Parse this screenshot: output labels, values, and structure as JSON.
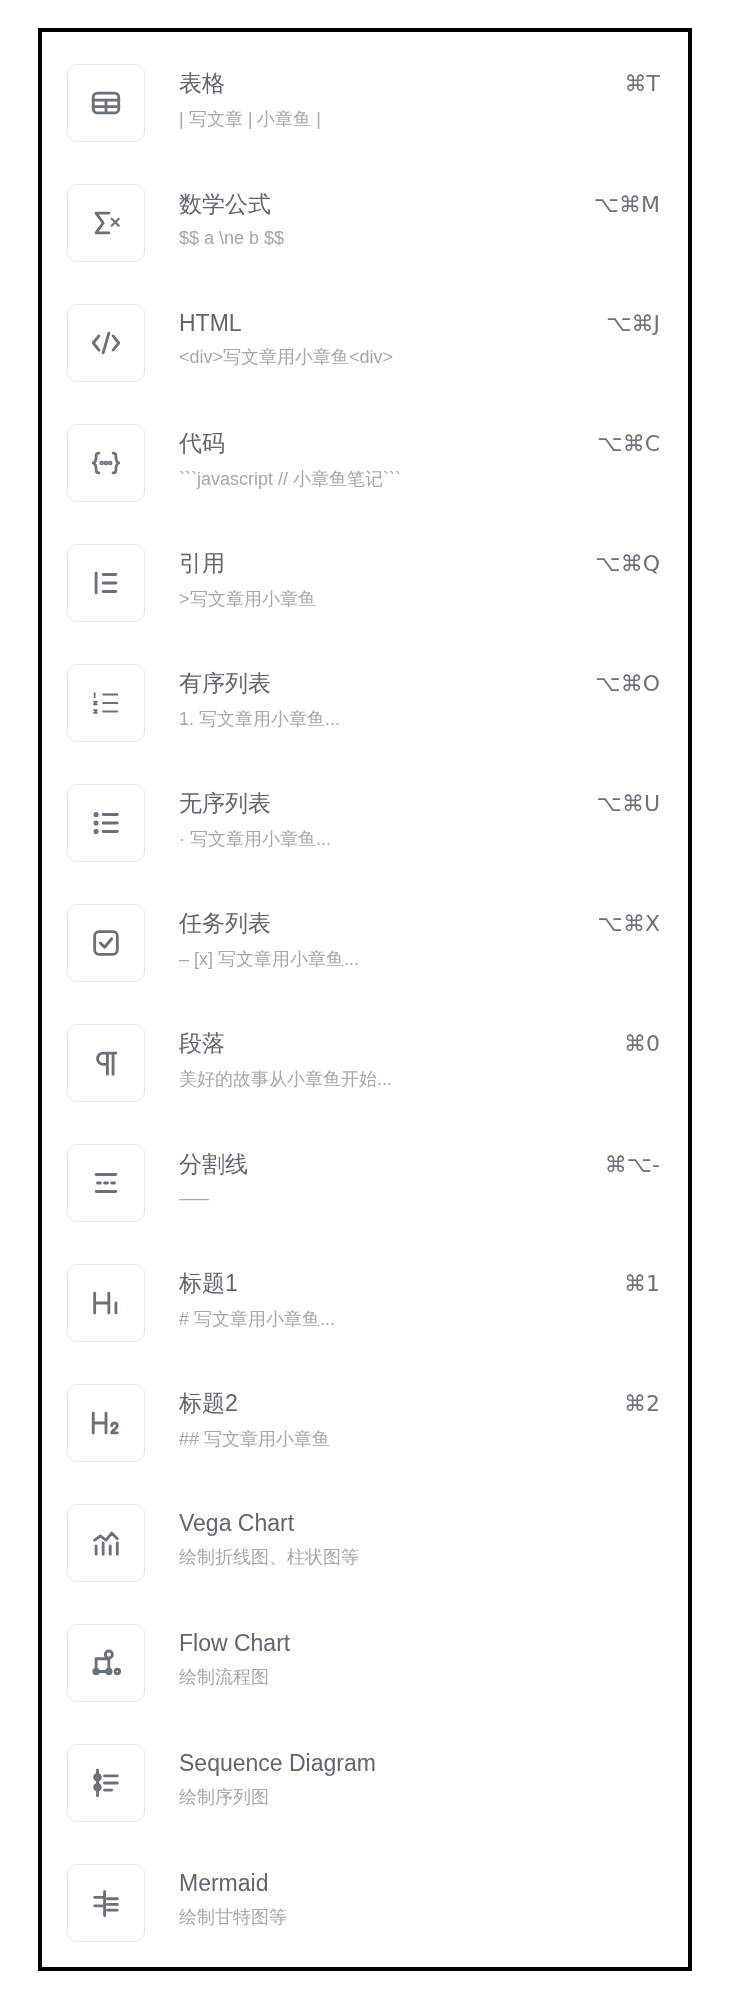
{
  "items": [
    {
      "kind": "table",
      "title": "表格",
      "hint": "| 写文章 | 小章鱼 |",
      "shortcut": "⌘T"
    },
    {
      "kind": "formula",
      "title": "数学公式",
      "hint": "$$ a \\ne b $$",
      "shortcut": "⌥⌘M"
    },
    {
      "kind": "html",
      "title": "HTML",
      "hint": "<div>写文章用小章鱼<div>",
      "shortcut": "⌥⌘J"
    },
    {
      "kind": "code",
      "title": "代码",
      "hint": "```javascript // 小章鱼笔记```",
      "shortcut": "⌥⌘C"
    },
    {
      "kind": "quote",
      "title": "引用",
      "hint": ">写文章用小章鱼",
      "shortcut": "⌥⌘Q"
    },
    {
      "kind": "ordered",
      "title": "有序列表",
      "hint": "1. 写文章用小章鱼...",
      "shortcut": "⌥⌘O"
    },
    {
      "kind": "bullet",
      "title": "无序列表",
      "hint": "· 写文章用小章鱼...",
      "shortcut": "⌥⌘U"
    },
    {
      "kind": "task",
      "title": "任务列表",
      "hint": "– [x] 写文章用小章鱼...",
      "shortcut": "⌥⌘X"
    },
    {
      "kind": "paragraph",
      "title": "段落",
      "hint": "美好的故事从小章鱼开始...",
      "shortcut": "⌘0"
    },
    {
      "kind": "divider",
      "title": "分割线",
      "hint": "–––",
      "shortcut": "⌘⌥-"
    },
    {
      "kind": "h1",
      "title": "标题1",
      "hint": "# 写文章用小章鱼...",
      "shortcut": "⌘1"
    },
    {
      "kind": "h2",
      "title": "标题2",
      "hint": "## 写文章用小章鱼",
      "shortcut": "⌘2"
    },
    {
      "kind": "chart",
      "title": "Vega Chart",
      "hint": "绘制折线图、柱状图等"
    },
    {
      "kind": "flow",
      "title": "Flow Chart",
      "hint": "绘制流程图"
    },
    {
      "kind": "sequence",
      "title": "Sequence Diagram",
      "hint": "绘制序列图"
    },
    {
      "kind": "gantt",
      "title": "Mermaid",
      "hint": "绘制甘特图等"
    }
  ]
}
